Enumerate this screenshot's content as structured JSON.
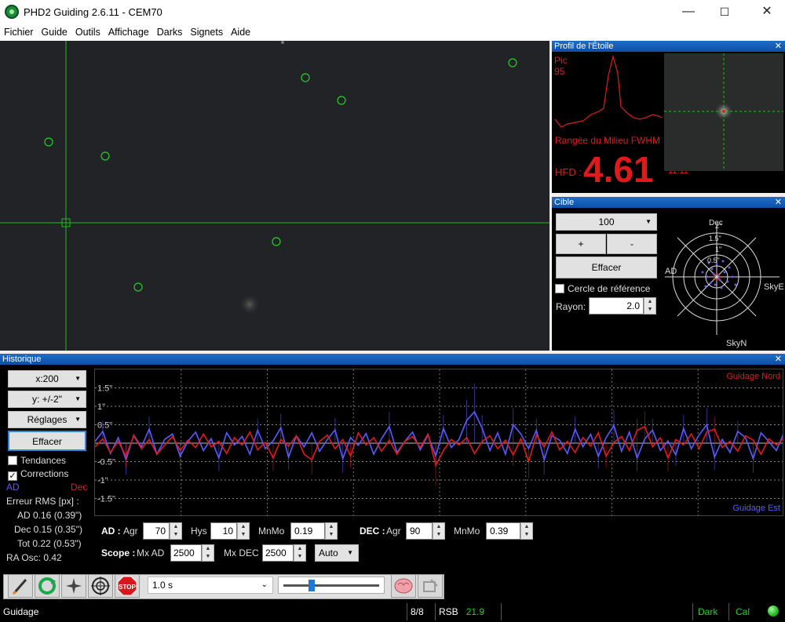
{
  "window": {
    "title": "PHD2 Guiding 2.6.11 - CEM70",
    "minimize": "—",
    "maximize": "☐",
    "close": "✕"
  },
  "menu": [
    "Fichier",
    "Guide",
    "Outils",
    "Affichage",
    "Darks",
    "Signets",
    "Aide"
  ],
  "star_profile": {
    "pane_title": "Profil de l'Étoile",
    "peak_label": "Pic",
    "peak_value": "95",
    "mode_label": "Rangée du Milieu FWHM",
    "hfd_label": "HFD :",
    "hfd_value": "4.61",
    "fwhm_value": "11.11"
  },
  "target": {
    "pane_title": "Cible",
    "scale_value": "100",
    "plus": "+",
    "minus": "-",
    "clear": "Effacer",
    "ref_circle": "Cercle de référence",
    "radius_label": "Rayon:",
    "radius_value": "2.0",
    "labels": {
      "dec": "Dec",
      "ad": "AD",
      "skye": "SkyE",
      "skyn": "SkyN"
    },
    "rings": [
      "2\"",
      "1.5\"",
      "1\"",
      "0.5\""
    ]
  },
  "history": {
    "pane_title": "Historique",
    "x_scale": "x:200",
    "y_scale": "y: +/-2\"",
    "settings": "Réglages",
    "clear": "Effacer",
    "trends": "Tendances",
    "corrections": "Corrections",
    "ad_label": "AD",
    "dec_label": "Dec",
    "rms_title": "Erreur RMS [px] :",
    "rms_ad": "AD 0.16 (0.39\")",
    "rms_dec": "Dec 0.15 (0.35\")",
    "rms_tot": "Tot 0.22 (0.53\")",
    "ra_osc": "RA Osc: 0.42",
    "guide_north": "Guidage Nord",
    "guide_east": "Guidage Est",
    "colors": {
      "ra": "#5a5aff",
      "dec": "#e01a1a"
    }
  },
  "chart_data": {
    "type": "line",
    "ylim": [
      -2,
      2
    ],
    "tick_labels": [
      "1.5\"",
      "1\"",
      "0.5\"",
      "-0.5\"",
      "-1\"",
      "-1.5\""
    ],
    "tick_values": [
      1.5,
      1,
      0.5,
      -0.5,
      -1,
      -1.5
    ],
    "series": [
      {
        "name": "AD",
        "values": [
          0.05,
          0.32,
          -0.28,
          0.15,
          -0.45,
          0.22,
          -0.1,
          0.38,
          -0.3,
          0.1,
          0.25,
          -0.35,
          0.05,
          0.3,
          -0.2,
          0.12,
          -0.4,
          0.28,
          -0.05,
          0.18,
          -0.3,
          0.35,
          -0.15,
          0.06,
          0.42,
          -0.38,
          0.2,
          -0.1,
          0.28,
          -0.22,
          0.1,
          0.36,
          -0.42,
          0.15,
          -0.06,
          0.26,
          -0.3,
          0.12,
          0.45,
          -0.25,
          0.05,
          0.3,
          -0.18,
          0.22,
          -0.35,
          0.4,
          -0.12,
          0.1,
          0.62,
          0.85,
          0.4,
          -0.2,
          0.28,
          -0.3,
          0.5,
          0.25,
          -0.15,
          0.35,
          -0.45,
          0.2,
          0.08,
          -0.28,
          0.38,
          -0.1,
          0.24,
          -0.36,
          0.15,
          0.48,
          -0.22,
          0.3,
          -0.4,
          0.12,
          0.35,
          -0.2,
          0.06,
          -0.32,
          0.4,
          -0.15,
          0.22,
          0.5,
          -0.38,
          0.1,
          -0.25,
          0.32,
          0.15,
          -0.42,
          0.28,
          0.05,
          -0.2,
          0.3
        ]
      },
      {
        "name": "Dec",
        "values": [
          -0.1,
          0.12,
          -0.25,
          0.05,
          -0.35,
          0.2,
          -0.15,
          0.1,
          -0.3,
          -0.05,
          0.18,
          -0.2,
          0.08,
          -0.12,
          0.25,
          -0.1,
          0.05,
          -0.28,
          0.15,
          -0.05,
          0.3,
          -0.18,
          0.02,
          -0.4,
          0.1,
          -0.08,
          0.2,
          -0.3,
          -0.45,
          0.05,
          0.22,
          -0.15,
          0.1,
          -0.35,
          0.28,
          -0.05,
          0.15,
          -0.22,
          0.08,
          -0.3,
          0.05,
          0.18,
          -0.12,
          0.25,
          -0.6,
          -0.2,
          0.1,
          -0.05,
          0.15,
          -0.28,
          0.05,
          0.2,
          -0.15,
          0.08,
          -0.32,
          0.12,
          -0.5,
          0.22,
          -0.1,
          0.3,
          -0.18,
          0.05,
          -0.25,
          0.15,
          -0.08,
          0.28,
          -0.35,
          0.02,
          0.18,
          -0.2,
          0.35,
          0.45,
          -0.1,
          0.15,
          -0.4,
          0.1,
          -0.05,
          0.25,
          -0.15,
          0.3,
          0.38,
          -0.12,
          0.05,
          -0.22,
          0.2,
          0.08,
          -0.3,
          0.12,
          -0.05,
          0.15
        ]
      }
    ]
  },
  "params": {
    "ad_label": "AD :",
    "agr_label": "Agr",
    "ad_agr": "70",
    "hys_label": "Hys",
    "ad_hys": "10",
    "mnmo_label": "MnMo",
    "ad_mnmo": "0.19",
    "dec_label": "DEC :",
    "dec_agr": "90",
    "dec_mnmo": "0.39",
    "scope_label": "Scope :",
    "mxad_label": "Mx AD",
    "mx_ad": "2500",
    "mxdec_label": "Mx DEC",
    "mx_dec": "2500",
    "mode": "Auto"
  },
  "toolbar": {
    "exposure": "1.0 s",
    "stop_label": "STOP"
  },
  "status": {
    "mode": "Guidage",
    "frames": "8/8",
    "snr_label": "RSB",
    "snr_value": "21.9",
    "dark": "Dark",
    "cal": "Cal"
  }
}
